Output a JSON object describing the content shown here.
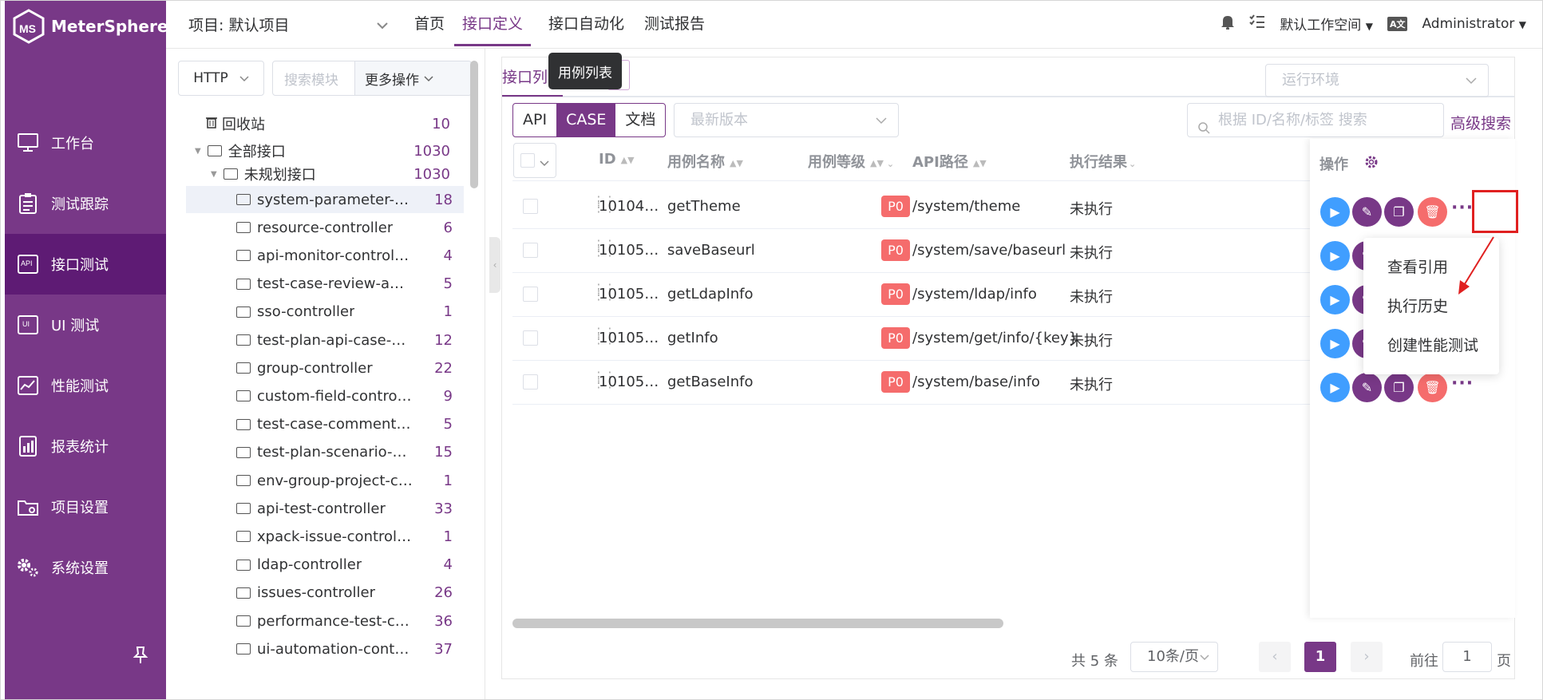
{
  "brand": "MeterSphere",
  "sidebar": {
    "items": [
      {
        "label": "工作台",
        "icon": "monitor-icon"
      },
      {
        "label": "测试跟踪",
        "icon": "clipboard-icon"
      },
      {
        "label": "接口测试",
        "icon": "api-icon"
      },
      {
        "label": "UI 测试",
        "icon": "ui-icon"
      },
      {
        "label": "性能测试",
        "icon": "chart-icon"
      },
      {
        "label": "报表统计",
        "icon": "report-icon"
      },
      {
        "label": "项目设置",
        "icon": "folder-settings-icon"
      },
      {
        "label": "系统设置",
        "icon": "gears-icon"
      }
    ],
    "active": 2
  },
  "header": {
    "project": "项目: 默认项目",
    "nav": [
      "首页",
      "接口定义",
      "接口自动化",
      "测试报告"
    ],
    "active_nav": 1,
    "workspace": "默认工作空间",
    "user": "Administrator"
  },
  "tree": {
    "protocol": "HTTP",
    "search_placeholder": "搜索模块",
    "more_ops": "更多操作",
    "recycle": {
      "label": "回收站",
      "count": "10"
    },
    "all": {
      "label": "全部接口",
      "count": "1030"
    },
    "unplanned": {
      "label": "未规划接口",
      "count": "1030"
    },
    "items": [
      {
        "label": "system-parameter-controller",
        "count": "18"
      },
      {
        "label": "resource-controller",
        "count": "6"
      },
      {
        "label": "api-monitor-controller",
        "count": "4"
      },
      {
        "label": "test-case-review-api-case-controller",
        "count": "5"
      },
      {
        "label": "sso-controller",
        "count": "1"
      },
      {
        "label": "test-plan-api-case-controller",
        "count": "12"
      },
      {
        "label": "group-controller",
        "count": "22"
      },
      {
        "label": "custom-field-controller",
        "count": "9"
      },
      {
        "label": "test-case-comment-controller",
        "count": "5"
      },
      {
        "label": "test-plan-scenario-case-controller",
        "count": "15"
      },
      {
        "label": "env-group-project-controller",
        "count": "1"
      },
      {
        "label": "api-test-controller",
        "count": "33"
      },
      {
        "label": "xpack-issue-controller",
        "count": "1"
      },
      {
        "label": "ldap-controller",
        "count": "4"
      },
      {
        "label": "issues-controller",
        "count": "26"
      },
      {
        "label": "performance-test-controller",
        "count": "36"
      },
      {
        "label": "ui-automation-controller",
        "count": "37"
      }
    ]
  },
  "main": {
    "tab": "接口列表",
    "tooltip": "用例列表",
    "env_placeholder": "运行环境",
    "segments": [
      "API",
      "CASE",
      "文档"
    ],
    "active_segment": 1,
    "version_placeholder": "最新版本",
    "search_placeholder": "根据 ID/名称/标签 搜索",
    "advanced_search": "高级搜索",
    "columns": {
      "id": "ID",
      "name": "用例名称",
      "level": "用例等级",
      "path": "API路径",
      "result": "执行结果",
      "ops": "操作"
    },
    "rows": [
      {
        "id": "10104…",
        "name": "getTheme",
        "level": "P0",
        "path": "/system/theme",
        "result": "未执行"
      },
      {
        "id": "10105…",
        "name": "saveBaseurl",
        "level": "P0",
        "path": "/system/save/baseurl",
        "result": "未执行"
      },
      {
        "id": "10105…",
        "name": "getLdapInfo",
        "level": "P0",
        "path": "/system/ldap/info",
        "result": "未执行"
      },
      {
        "id": "10105…",
        "name": "getInfo",
        "level": "P0",
        "path": "/system/get/info/{key}",
        "result": "未执行"
      },
      {
        "id": "10105…",
        "name": "getBaseInfo",
        "level": "P0",
        "path": "/system/base/info",
        "result": "未执行"
      }
    ],
    "more_menu": [
      "查看引用",
      "执行历史",
      "创建性能测试"
    ],
    "pager": {
      "total": "共 5 条",
      "page_size": "10条/页",
      "current": "1",
      "goto_label": "前往",
      "goto_value": "1",
      "page_unit": "页"
    }
  },
  "colors": {
    "primary": "#783887",
    "sidebar_active": "#5e1b74",
    "run": "#409eff",
    "danger": "#f56c6c"
  }
}
